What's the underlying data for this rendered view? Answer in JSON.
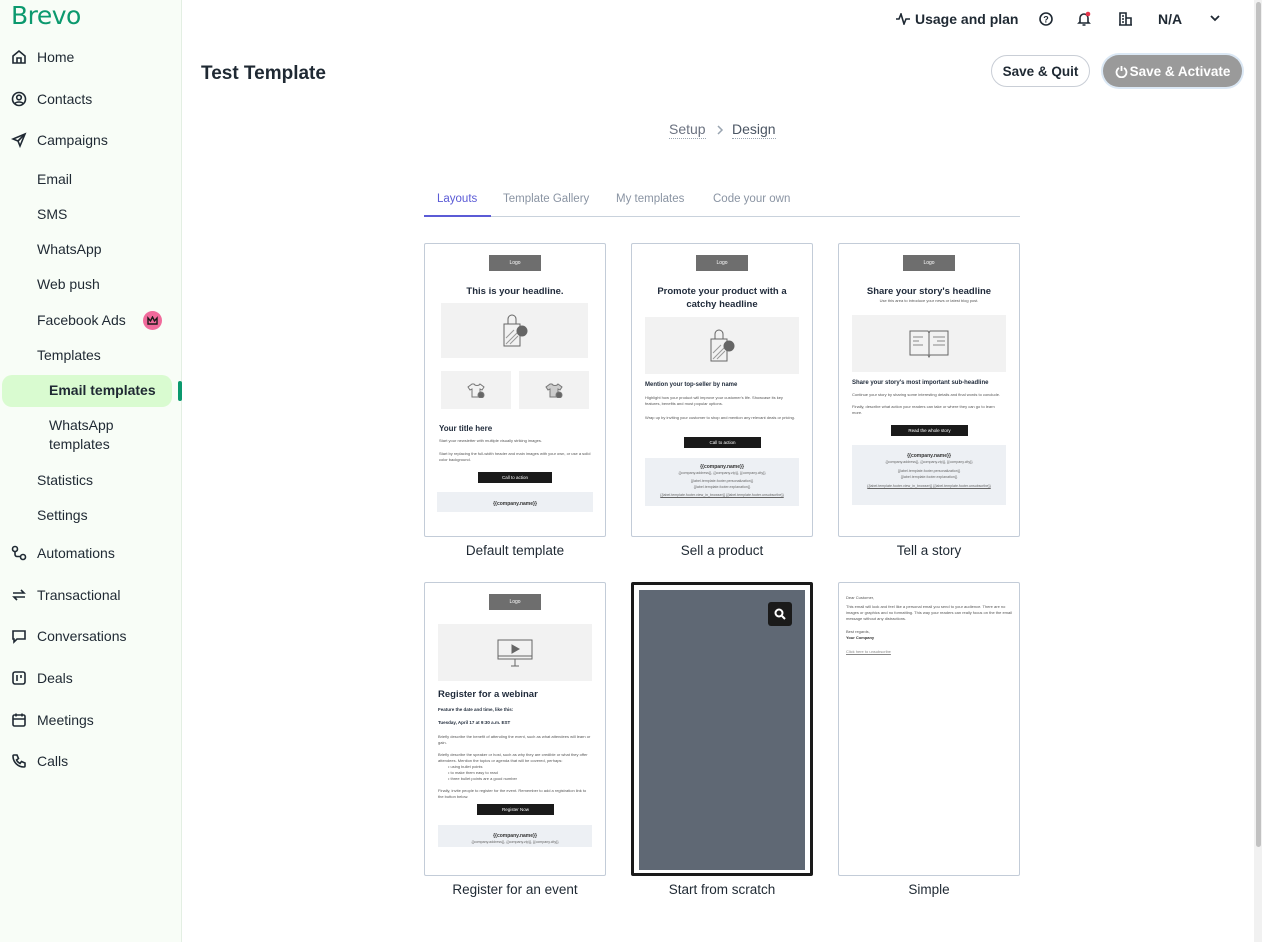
{
  "brand": {
    "logo": "Brevo",
    "color": "#0b996e"
  },
  "sidebar": {
    "items": [
      {
        "label": "Home",
        "icon": "home-icon"
      },
      {
        "label": "Contacts",
        "icon": "contacts-icon"
      },
      {
        "label": "Campaigns",
        "icon": "send-icon"
      },
      {
        "label": "Email"
      },
      {
        "label": "SMS"
      },
      {
        "label": "WhatsApp"
      },
      {
        "label": "Web push"
      },
      {
        "label": "Facebook Ads",
        "badge_icon": "crown-icon"
      },
      {
        "label": "Templates"
      },
      {
        "label": "Email templates",
        "active": true
      },
      {
        "label": "WhatsApp templates"
      },
      {
        "label": "Statistics"
      },
      {
        "label": "Settings"
      },
      {
        "label": "Automations",
        "icon": "automations-icon"
      },
      {
        "label": "Transactional",
        "icon": "transactional-icon"
      },
      {
        "label": "Conversations",
        "icon": "conversations-icon"
      },
      {
        "label": "Deals",
        "icon": "deals-icon"
      },
      {
        "label": "Meetings",
        "icon": "calendar-icon"
      },
      {
        "label": "Calls",
        "icon": "phone-icon"
      }
    ]
  },
  "topbar": {
    "usage": "Usage and plan",
    "account": "N/A"
  },
  "header": {
    "title": "Test Template",
    "save_quit": "Save & Quit",
    "save_activate": "Save & Activate"
  },
  "breadcrumb": {
    "step1": "Setup",
    "step2": "Design"
  },
  "tabs": [
    "Layouts",
    "Template Gallery",
    "My templates",
    "Code your own"
  ],
  "templates": [
    {
      "name": "Default template",
      "logo": "Logo",
      "headline": "This is your headline.",
      "title": "Your title here",
      "p1": "Start your newsletter with multiple visually striking images.",
      "p2": "Start by replacing the full-width header and main images with your own, or use a solid color background.",
      "cta": "Call to action",
      "footer": "{{company.name}}"
    },
    {
      "name": "Sell a product",
      "logo": "Logo",
      "headline": "Promote your product with a catchy headline",
      "title": "Mention your top-seller by name",
      "p1": "Highlight how your product will improve your customer's life. Showcase its key features, benefits and most popular options.",
      "p2": "Wrap up by inviting your customer to shop and mention any relevant deals or pricing.",
      "cta": "Call to action",
      "footer": "{{company.name}}",
      "footer2": "{{company.address}}, {{company.zip}}, {{company.city}}",
      "footer3": "{{label.template.footer.personalization}}",
      "footer4": "{{label.template.footer.explanation}}",
      "footer5": "{{label.template.footer.view_in_browser}} {{label.template.footer.unsubscribe}}"
    },
    {
      "name": "Tell a story",
      "logo": "Logo",
      "headline": "Share your story's headline",
      "intro": "Use this area to introduce your news or latest blog post.",
      "title": "Share your story's most important sub-headline",
      "p1": "Continue your story by sharing some interesting details and final words to conclude.",
      "p2": "Finally, describe what action your readers can take or where they can go to learn more.",
      "cta": "Read the whole story",
      "footer": "{{company.name}}",
      "footer2": "{{company.address}}, {{company.zip}}, {{company.city}}",
      "footer3": "{{label.template.footer.personalization}}",
      "footer4": "{{label.template.footer.explanation}}",
      "footer5": "{{label.template.footer.view_in_browser}} {{label.template.footer.unsubscribe}}"
    },
    {
      "name": "Register for an event",
      "logo": "Logo",
      "headline": "Register for a webinar",
      "s1": "Feature the date and time, like this:",
      "s2": "Tuesday, April 17 at 9:30 a.m. EST",
      "p1": "Briefly describe the benefit of attending the event, such as what attendees will learn or gain.",
      "p2": "Briefly describe the speaker or host, such as why they are credible or what they offer attendees. Mention the topics or agenda that will be covered, perhaps:",
      "bullets": [
        "using bullet points",
        "to make them easy to read",
        "three bullet points are a good number"
      ],
      "p3": "Finally, invite people to register for the event. Remember to add a registration link to the button below.",
      "cta": "Register Now",
      "footer": "{{company.name}}",
      "footer2": "{{company.address}}, {{company.zip}}, {{company.city}}"
    },
    {
      "name": "Start from scratch",
      "preview_color": "#5f6874"
    },
    {
      "name": "Simple",
      "greeting": "Dear Customer,",
      "p1": "This email will look and feel like a personal email you send to your audience. There are no images or graphics and no formatting. This way your readers can really focus on the the email message without any distractions.",
      "regards": "Best regards,",
      "company": "Your Company",
      "unsub": "Click here to unsubscribe"
    }
  ]
}
